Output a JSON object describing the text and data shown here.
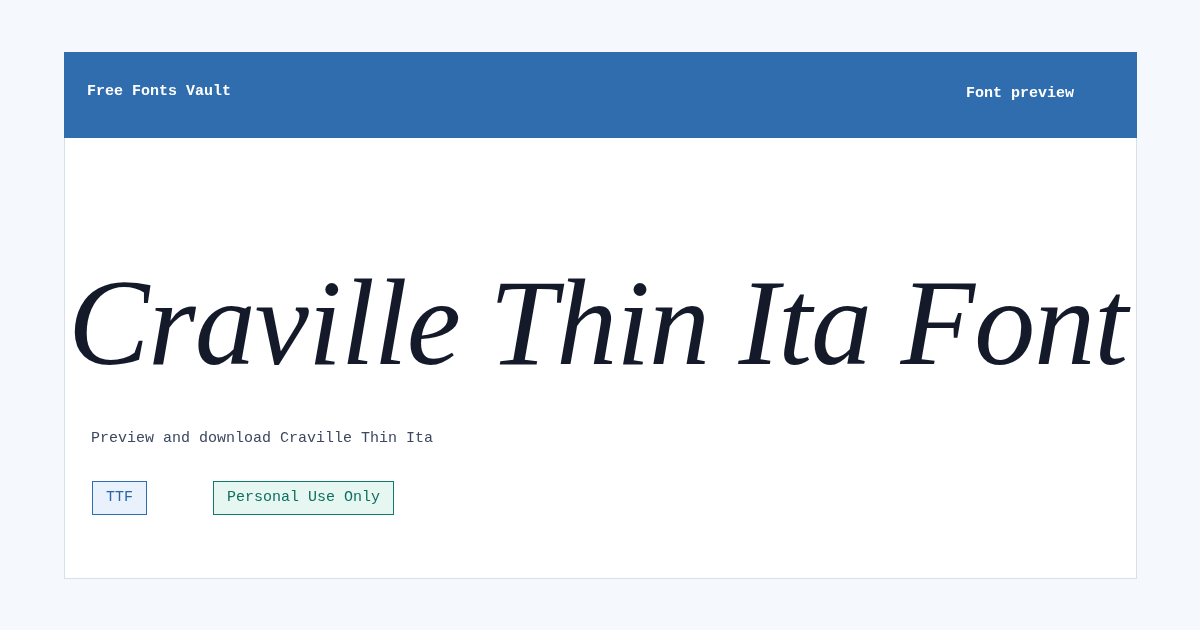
{
  "header": {
    "brand": "Free Fonts Vault",
    "link": "Font preview"
  },
  "preview": {
    "title": "Craville Thin Ita Font",
    "subtitle": "Preview and download Craville Thin Ita"
  },
  "tags": [
    {
      "label": "TTF",
      "kind": "format"
    },
    {
      "label": "Personal Use Only",
      "kind": "license"
    }
  ]
}
